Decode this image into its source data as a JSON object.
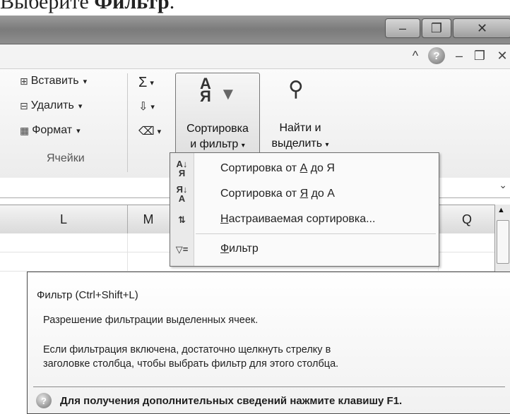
{
  "caption": {
    "text": "Выберите ",
    "bold": "Фильтр",
    "end": "."
  },
  "window_controls": {
    "minimize": "–",
    "restore": "❐",
    "close": "✕"
  },
  "ribbon_controls": {
    "collapse": "^",
    "help": "?",
    "minimize": "–",
    "restore": "❐",
    "close": "✕"
  },
  "cells_group": {
    "insert": "Вставить",
    "delete": "Удалить",
    "format": "Формат",
    "group_label": "Ячейки"
  },
  "editing_group": {
    "sort_line1": "Сортировка",
    "sort_line2": "и фильтр",
    "find_line1": "Найти и",
    "find_line2": "выделить"
  },
  "columns": [
    "L",
    "M",
    "Q"
  ],
  "sort_menu": {
    "items": [
      {
        "prefix": "Сортировка от ",
        "u": "А",
        "suffix": " до Я"
      },
      {
        "prefix": "Сортировка от ",
        "u": "Я",
        "suffix": " до А"
      },
      {
        "prefix": "",
        "u": "Н",
        "suffix": "астраиваемая сортировка..."
      },
      {
        "prefix": "",
        "u": "Ф",
        "suffix": "ильтр"
      }
    ]
  },
  "tooltip": {
    "title": "Фильтр (Ctrl+Shift+L)",
    "line1": "Разрешение фильтрации выделенных ячеек.",
    "line2": "Если фильтрация включена, достаточно щелкнуть стрелку в",
    "line3": "заголовке столбца, чтобы выбрать фильтр для этого столбца.",
    "help": "Для получения дополнительных сведений нажмите клавишу F1."
  }
}
